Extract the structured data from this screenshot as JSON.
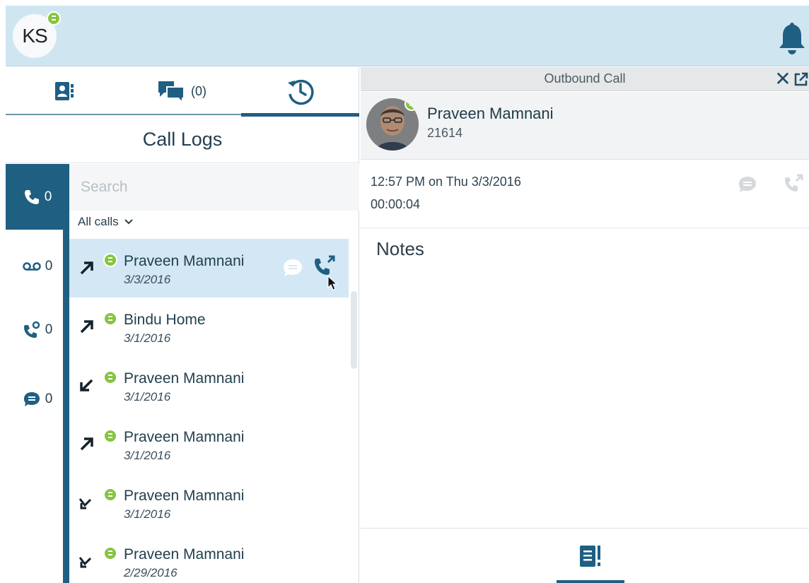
{
  "user": {
    "initials": "KS",
    "status": "available"
  },
  "tabs": [
    {
      "id": "contacts",
      "icon": "contacts-icon"
    },
    {
      "id": "chat",
      "icon": "chat-icon",
      "count": "(0)"
    },
    {
      "id": "history",
      "icon": "history-icon",
      "active": true
    }
  ],
  "panel": {
    "title": "Call Logs"
  },
  "filters": [
    {
      "id": "calls",
      "icon": "phone-icon",
      "count": "0",
      "active": true
    },
    {
      "id": "voicemail",
      "icon": "voicemail-icon",
      "count": "0"
    },
    {
      "id": "missed",
      "icon": "missed-call-icon",
      "count": "0"
    },
    {
      "id": "messages",
      "icon": "message-icon",
      "count": "0"
    }
  ],
  "search": {
    "placeholder": "Search",
    "value": ""
  },
  "call_filter": {
    "selected": "All calls"
  },
  "calls": [
    {
      "name": "Praveen Mamnani",
      "date": "3/3/2016",
      "direction": "outgoing",
      "selected": true
    },
    {
      "name": "Bindu Home",
      "date": "3/1/2016",
      "direction": "outgoing"
    },
    {
      "name": "Praveen Mamnani",
      "date": "3/1/2016",
      "direction": "incoming"
    },
    {
      "name": "Praveen Mamnani",
      "date": "3/1/2016",
      "direction": "outgoing"
    },
    {
      "name": "Praveen Mamnani",
      "date": "3/1/2016",
      "direction": "missed"
    },
    {
      "name": "Praveen Mamnani",
      "date": "2/29/2016",
      "direction": "missed"
    }
  ],
  "detail": {
    "header": "Outbound Call",
    "contact_name": "Praveen Mamnani",
    "contact_ext": "21614",
    "call_time": "12:57 PM on Thu 3/3/2016",
    "duration": "00:00:04",
    "notes_label": "Notes"
  },
  "colors": {
    "brand_dark": "#1f5f82",
    "topbar": "#cfe6f1",
    "presence": "#86c440",
    "selected_row": "#d3e8f4"
  }
}
